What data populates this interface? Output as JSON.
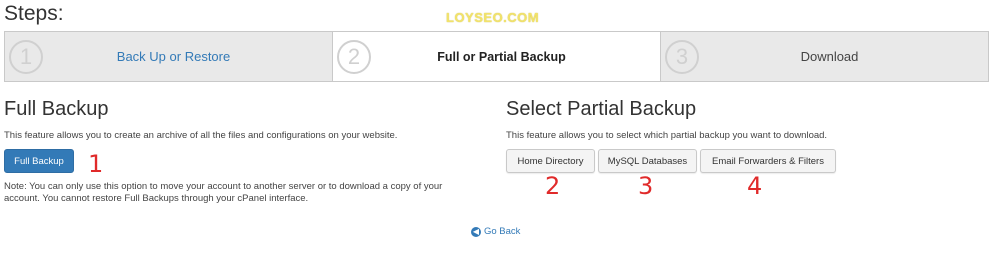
{
  "header": {
    "title": "Steps:",
    "watermark": "LOYSEO.COM"
  },
  "steps": [
    {
      "number": "1",
      "label": "Back Up or Restore"
    },
    {
      "number": "2",
      "label": "Full or Partial Backup"
    },
    {
      "number": "3",
      "label": "Download"
    }
  ],
  "full_backup": {
    "title": "Full Backup",
    "description": "This feature allows you to create an archive of all the files and configurations on your website.",
    "button_label": "Full Backup",
    "note_line1": "Note: You can only use this option to move your account to another server or to download a copy of your",
    "note_line2": "account. You cannot restore Full Backups through your cPanel interface."
  },
  "partial_backup": {
    "title": "Select Partial Backup",
    "description": "This feature allows you to select which partial backup you want to download.",
    "buttons": [
      "Home Directory",
      "MySQL Databases",
      "Email Forwarders & Filters"
    ]
  },
  "annotations": [
    "1",
    "2",
    "3",
    "4"
  ],
  "footer": {
    "go_back_label": "Go Back"
  },
  "colors": {
    "link": "#337ab7",
    "primary_button": "#337ab7",
    "annotation": "#e02a2a"
  }
}
